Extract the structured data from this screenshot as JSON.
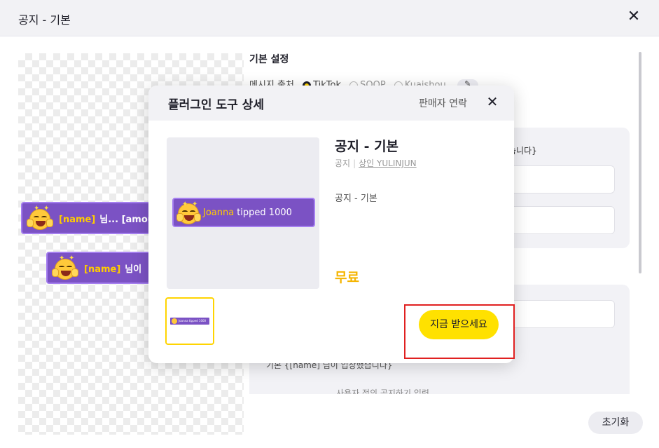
{
  "window": {
    "title": "공지 - 기본",
    "close_label": "✕"
  },
  "preview_alerts": [
    {
      "name": "[name]",
      "text": "님... [amou"
    },
    {
      "name": "[name]",
      "text": "님이"
    }
  ],
  "settings": {
    "heading": "기본 설정",
    "source_label": "메시지 출처",
    "sources": [
      "TikTok",
      "SOOP",
      "Kuaishou"
    ],
    "note": "습니다}",
    "bottom_option": "기본 {[name] 님이 입장했습니다}",
    "custom_label": "사용자 정의",
    "custom_placeholder": "공지하기 입력"
  },
  "reset_button": "초기화",
  "modal": {
    "title": "플러그인 도구 상세",
    "contact_seller": "판매자 연락",
    "close_label": "✕",
    "preview_alert": {
      "name": "Joanna",
      "text": "tipped 1000"
    },
    "thumb_text": "Joanna tipped 1000",
    "product_name": "공지 - 기본",
    "category": "공지",
    "seller": "상인 YULINJUN",
    "description": "공지  - 기본",
    "price": "무료",
    "get_button": "지금 받으세요"
  },
  "colors": {
    "accent": "#ffe100",
    "price": "#f5b400",
    "alert_bg": "#7b52c4",
    "highlight": "#e02020"
  }
}
